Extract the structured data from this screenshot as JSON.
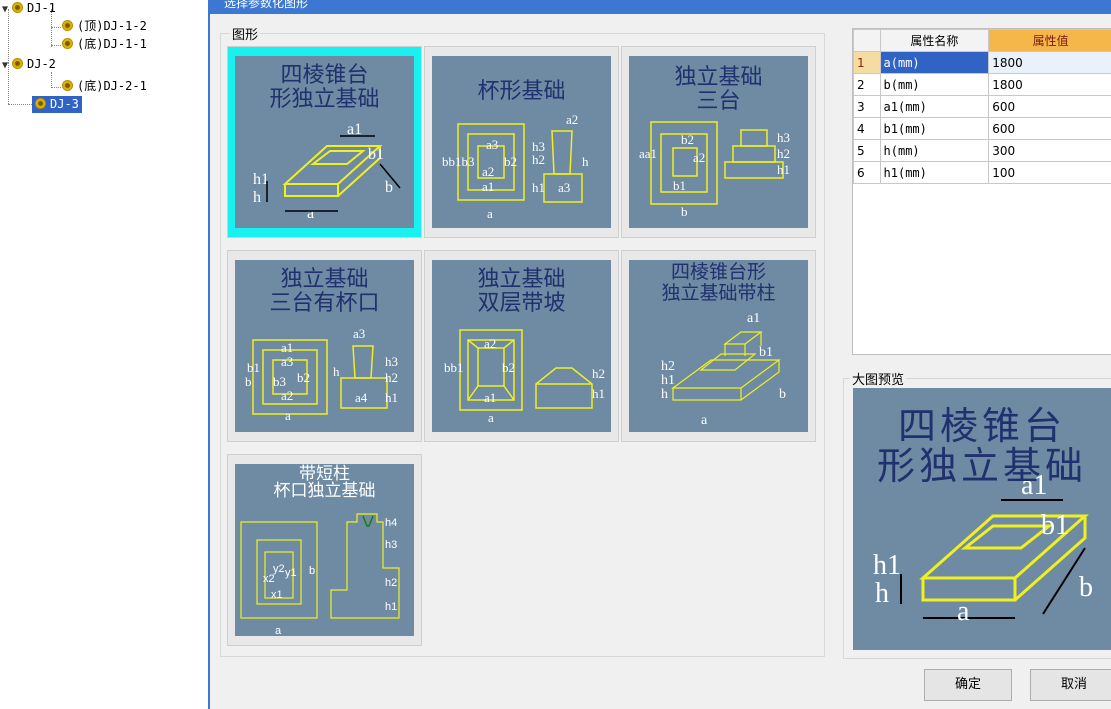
{
  "tree": {
    "items": [
      {
        "label": "DJ-1",
        "level": 0,
        "expanded": true
      },
      {
        "label": "(顶)DJ-1-2",
        "level": 1
      },
      {
        "label": "(底)DJ-1-1",
        "level": 1
      },
      {
        "label": "DJ-2",
        "level": 0,
        "expanded": true
      },
      {
        "label": "(底)DJ-2-1",
        "level": 1
      },
      {
        "label": "DJ-3",
        "level": 0,
        "selected": true
      }
    ]
  },
  "dialog": {
    "title": "选择参数化图形",
    "shapes_group_label": "图形",
    "preview_group_label": "大图预览",
    "ok_label": "确定",
    "cancel_label": "取消",
    "tiles": [
      {
        "title": "四棱锥台\n形独立基础",
        "labels": [
          "a1",
          "b1",
          "h1",
          "h",
          "a",
          "b"
        ],
        "selected": true
      },
      {
        "title": "杯形基础",
        "labels": [
          "a3",
          "b",
          "b1",
          "b3",
          "b2",
          "a2",
          "a1",
          "a",
          "a2",
          "h3",
          "h2",
          "h",
          "h1",
          "a3"
        ]
      },
      {
        "title": "独立基础\n三台",
        "labels": [
          "a",
          "a1",
          "b2",
          "a2",
          "b1",
          "b",
          "h3",
          "h2",
          "h1"
        ]
      },
      {
        "title": "独立基础\n三台有杯口",
        "labels": [
          "a1",
          "b1",
          "a3",
          "b3",
          "b2",
          "a2",
          "b",
          "a",
          "a3",
          "h",
          "h3",
          "h2",
          "a4",
          "h1"
        ]
      },
      {
        "title": "独立基础\n双层带坡",
        "labels": [
          "a2",
          "b",
          "b1",
          "b2",
          "a1",
          "a",
          "h2",
          "h1"
        ]
      },
      {
        "title": "四棱锥台形\n独立基础带柱",
        "labels": [
          "a1",
          "b1",
          "h2",
          "h1",
          "h",
          "b",
          "a"
        ]
      },
      {
        "title": "带短柱\n杯口独立基础",
        "labels": [
          "x2",
          "y2",
          "y1",
          "x1",
          "b",
          "a",
          "h4",
          "h3",
          "h2",
          "h1"
        ]
      }
    ],
    "preview": {
      "title": "四棱锥台\n形独立基础",
      "labels": [
        "a1",
        "b1",
        "h1",
        "h",
        "b",
        "a"
      ]
    }
  },
  "properties": {
    "headers": [
      "",
      "属性名称",
      "属性值"
    ],
    "rows": [
      {
        "index": "1",
        "name": "a(mm)",
        "value": "1800"
      },
      {
        "index": "2",
        "name": "b(mm)",
        "value": "1800"
      },
      {
        "index": "3",
        "name": "a1(mm)",
        "value": "600"
      },
      {
        "index": "4",
        "name": "b1(mm)",
        "value": "600"
      },
      {
        "index": "5",
        "name": "h(mm)",
        "value": "300"
      },
      {
        "index": "6",
        "name": "h1(mm)",
        "value": "100"
      }
    ]
  },
  "colors": {
    "accent": "#3c78d2",
    "selection": "#19f0f0",
    "thumb_bg": "#6e8ba3",
    "drawing": "#f0f020",
    "header_highlight": "#f5b74a"
  }
}
